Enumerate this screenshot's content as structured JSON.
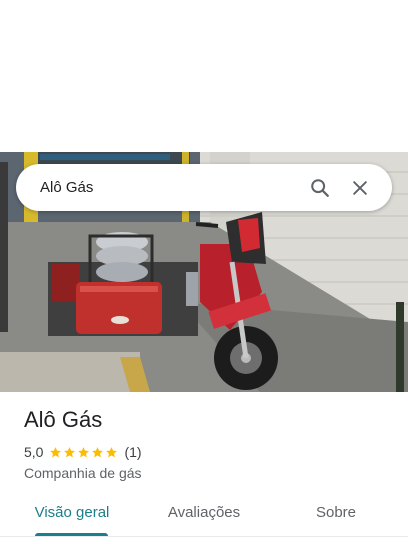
{
  "search": {
    "value": "Alô Gás",
    "search_icon": "search-icon",
    "clear_icon": "close-icon"
  },
  "place": {
    "name": "Alô Gás",
    "rating": "5,0",
    "rating_value": 5.0,
    "review_count": "(1)",
    "category": "Companhia de gás"
  },
  "tabs": [
    {
      "label": "Visão geral",
      "active": true
    },
    {
      "label": "Avaliações",
      "active": false
    },
    {
      "label": "Sobre",
      "active": false
    }
  ],
  "colors": {
    "accent": "#1a7f8a",
    "star": "#fbbc04",
    "text_primary": "#202124",
    "text_secondary": "#5f6368"
  }
}
